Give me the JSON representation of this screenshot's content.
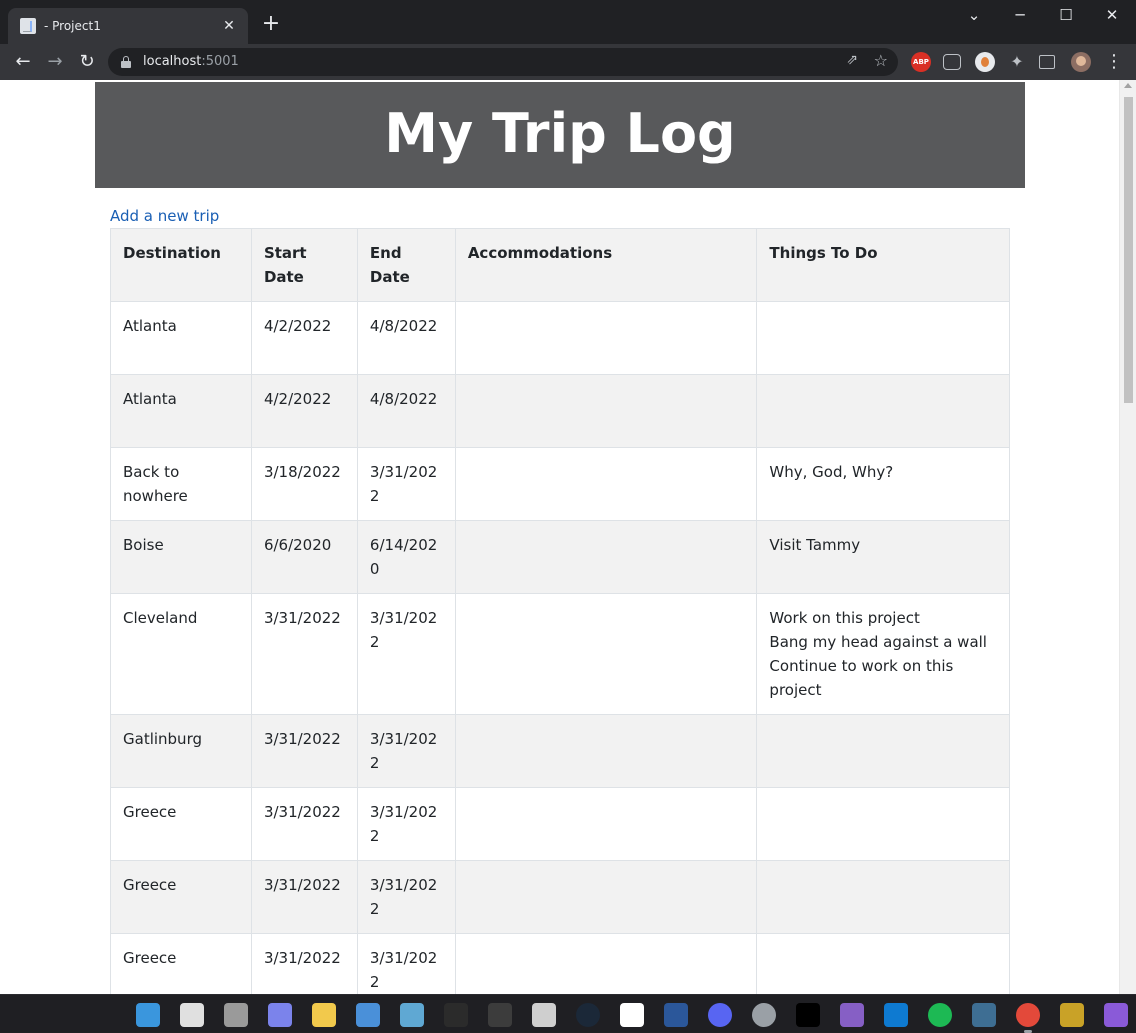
{
  "browser": {
    "tab_title": "- Project1",
    "tab_close": "✕",
    "new_tab": "+",
    "url_host": "localhost",
    "url_port": ":5001",
    "back": "←",
    "forward": "→",
    "reload": "↻",
    "share": "⇗",
    "star": "☆",
    "ext_abp": "ABP",
    "menu": "⋮",
    "window_chevron": "⌄",
    "window_min": "─",
    "window_max": "☐",
    "window_close": "✕"
  },
  "page": {
    "banner_title": "My Trip Log",
    "add_link": "Add a new trip",
    "columns": [
      "Destination",
      "Start Date",
      "End Date",
      "Accommodations",
      "Things To Do"
    ],
    "rows": [
      {
        "destination": "Atlanta",
        "start": "4/2/2022",
        "end": "4/8/2022",
        "accommodations": "",
        "todo": []
      },
      {
        "destination": "Atlanta",
        "start": "4/2/2022",
        "end": "4/8/2022",
        "accommodations": "",
        "todo": []
      },
      {
        "destination": "Back to nowhere",
        "start": "3/18/2022",
        "end": "3/31/2022",
        "accommodations": "",
        "todo": [
          "Why, God, Why?"
        ]
      },
      {
        "destination": "Boise",
        "start": "6/6/2020",
        "end": "6/14/2020",
        "accommodations": "",
        "todo": [
          "Visit Tammy"
        ]
      },
      {
        "destination": "Cleveland",
        "start": "3/31/2022",
        "end": "3/31/2022",
        "accommodations": "",
        "todo": [
          "Work on this project",
          "Bang my head against a wall",
          "Continue to work on this project"
        ]
      },
      {
        "destination": "Gatlinburg",
        "start": "3/31/2022",
        "end": "3/31/2022",
        "accommodations": "",
        "todo": []
      },
      {
        "destination": "Greece",
        "start": "3/31/2022",
        "end": "3/31/2022",
        "accommodations": "",
        "todo": []
      },
      {
        "destination": "Greece",
        "start": "3/31/2022",
        "end": "3/31/2022",
        "accommodations": "",
        "todo": []
      },
      {
        "destination": "Greece",
        "start": "3/31/2022",
        "end": "3/31/2022",
        "accommodations": "",
        "todo": []
      },
      {
        "destination": "",
        "start": "",
        "end": "",
        "accommodations": "",
        "todo": []
      }
    ]
  },
  "taskbar": {
    "icons": [
      "windows-start-icon",
      "search-icon",
      "task-view-icon",
      "teams-chat-icon",
      "file-explorer-icon",
      "remote-desktop-icon",
      "task-manager-icon",
      "terminal-icon",
      "powershell-icon",
      "speedometer-icon",
      "steam-icon",
      "oculus-icon",
      "word-icon",
      "discord-icon",
      "settings-icon",
      "jetbrains-icon",
      "visual-studio-icon",
      "vs-code-icon",
      "spotify-icon",
      "mysql-workbench-icon",
      "chrome-icon",
      "app-icon",
      "visual-studio-preview-icon"
    ],
    "colors": [
      "#3a96dd",
      "#e0e0e0",
      "#9a9a9a",
      "#7b83eb",
      "#f2c94c",
      "#4a90d9",
      "#5fa8d3",
      "#2b2b2b",
      "#3c3c3c",
      "#cfcfcf",
      "#1b2838",
      "#ffffff",
      "#2b579a",
      "#5865f2",
      "#9aa0a6",
      "#000000",
      "#865fc5",
      "#0e7ad1",
      "#1db954",
      "#3e6e93",
      "#e3493a",
      "#c9a227",
      "#8a5ad8"
    ]
  }
}
